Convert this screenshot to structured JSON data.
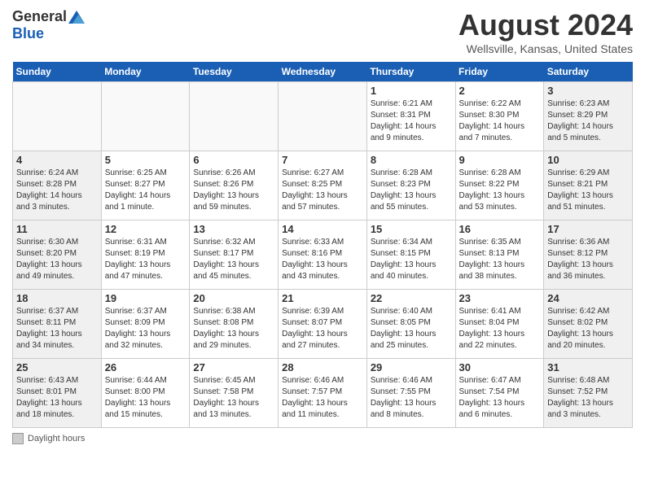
{
  "header": {
    "logo_general": "General",
    "logo_blue": "Blue",
    "month_year": "August 2024",
    "location": "Wellsville, Kansas, United States"
  },
  "days_of_week": [
    "Sunday",
    "Monday",
    "Tuesday",
    "Wednesday",
    "Thursday",
    "Friday",
    "Saturday"
  ],
  "legend": {
    "label": "Daylight hours"
  },
  "weeks": [
    [
      {
        "date": "",
        "sunrise": "",
        "sunset": "",
        "daylight": ""
      },
      {
        "date": "",
        "sunrise": "",
        "sunset": "",
        "daylight": ""
      },
      {
        "date": "",
        "sunrise": "",
        "sunset": "",
        "daylight": ""
      },
      {
        "date": "",
        "sunrise": "",
        "sunset": "",
        "daylight": ""
      },
      {
        "date": "1",
        "sunrise": "Sunrise: 6:21 AM",
        "sunset": "Sunset: 8:31 PM",
        "daylight": "Daylight: 14 hours and 9 minutes."
      },
      {
        "date": "2",
        "sunrise": "Sunrise: 6:22 AM",
        "sunset": "Sunset: 8:30 PM",
        "daylight": "Daylight: 14 hours and 7 minutes."
      },
      {
        "date": "3",
        "sunrise": "Sunrise: 6:23 AM",
        "sunset": "Sunset: 8:29 PM",
        "daylight": "Daylight: 14 hours and 5 minutes."
      }
    ],
    [
      {
        "date": "4",
        "sunrise": "Sunrise: 6:24 AM",
        "sunset": "Sunset: 8:28 PM",
        "daylight": "Daylight: 14 hours and 3 minutes."
      },
      {
        "date": "5",
        "sunrise": "Sunrise: 6:25 AM",
        "sunset": "Sunset: 8:27 PM",
        "daylight": "Daylight: 14 hours and 1 minute."
      },
      {
        "date": "6",
        "sunrise": "Sunrise: 6:26 AM",
        "sunset": "Sunset: 8:26 PM",
        "daylight": "Daylight: 13 hours and 59 minutes."
      },
      {
        "date": "7",
        "sunrise": "Sunrise: 6:27 AM",
        "sunset": "Sunset: 8:25 PM",
        "daylight": "Daylight: 13 hours and 57 minutes."
      },
      {
        "date": "8",
        "sunrise": "Sunrise: 6:28 AM",
        "sunset": "Sunset: 8:23 PM",
        "daylight": "Daylight: 13 hours and 55 minutes."
      },
      {
        "date": "9",
        "sunrise": "Sunrise: 6:28 AM",
        "sunset": "Sunset: 8:22 PM",
        "daylight": "Daylight: 13 hours and 53 minutes."
      },
      {
        "date": "10",
        "sunrise": "Sunrise: 6:29 AM",
        "sunset": "Sunset: 8:21 PM",
        "daylight": "Daylight: 13 hours and 51 minutes."
      }
    ],
    [
      {
        "date": "11",
        "sunrise": "Sunrise: 6:30 AM",
        "sunset": "Sunset: 8:20 PM",
        "daylight": "Daylight: 13 hours and 49 minutes."
      },
      {
        "date": "12",
        "sunrise": "Sunrise: 6:31 AM",
        "sunset": "Sunset: 8:19 PM",
        "daylight": "Daylight: 13 hours and 47 minutes."
      },
      {
        "date": "13",
        "sunrise": "Sunrise: 6:32 AM",
        "sunset": "Sunset: 8:17 PM",
        "daylight": "Daylight: 13 hours and 45 minutes."
      },
      {
        "date": "14",
        "sunrise": "Sunrise: 6:33 AM",
        "sunset": "Sunset: 8:16 PM",
        "daylight": "Daylight: 13 hours and 43 minutes."
      },
      {
        "date": "15",
        "sunrise": "Sunrise: 6:34 AM",
        "sunset": "Sunset: 8:15 PM",
        "daylight": "Daylight: 13 hours and 40 minutes."
      },
      {
        "date": "16",
        "sunrise": "Sunrise: 6:35 AM",
        "sunset": "Sunset: 8:13 PM",
        "daylight": "Daylight: 13 hours and 38 minutes."
      },
      {
        "date": "17",
        "sunrise": "Sunrise: 6:36 AM",
        "sunset": "Sunset: 8:12 PM",
        "daylight": "Daylight: 13 hours and 36 minutes."
      }
    ],
    [
      {
        "date": "18",
        "sunrise": "Sunrise: 6:37 AM",
        "sunset": "Sunset: 8:11 PM",
        "daylight": "Daylight: 13 hours and 34 minutes."
      },
      {
        "date": "19",
        "sunrise": "Sunrise: 6:37 AM",
        "sunset": "Sunset: 8:09 PM",
        "daylight": "Daylight: 13 hours and 32 minutes."
      },
      {
        "date": "20",
        "sunrise": "Sunrise: 6:38 AM",
        "sunset": "Sunset: 8:08 PM",
        "daylight": "Daylight: 13 hours and 29 minutes."
      },
      {
        "date": "21",
        "sunrise": "Sunrise: 6:39 AM",
        "sunset": "Sunset: 8:07 PM",
        "daylight": "Daylight: 13 hours and 27 minutes."
      },
      {
        "date": "22",
        "sunrise": "Sunrise: 6:40 AM",
        "sunset": "Sunset: 8:05 PM",
        "daylight": "Daylight: 13 hours and 25 minutes."
      },
      {
        "date": "23",
        "sunrise": "Sunrise: 6:41 AM",
        "sunset": "Sunset: 8:04 PM",
        "daylight": "Daylight: 13 hours and 22 minutes."
      },
      {
        "date": "24",
        "sunrise": "Sunrise: 6:42 AM",
        "sunset": "Sunset: 8:02 PM",
        "daylight": "Daylight: 13 hours and 20 minutes."
      }
    ],
    [
      {
        "date": "25",
        "sunrise": "Sunrise: 6:43 AM",
        "sunset": "Sunset: 8:01 PM",
        "daylight": "Daylight: 13 hours and 18 minutes."
      },
      {
        "date": "26",
        "sunrise": "Sunrise: 6:44 AM",
        "sunset": "Sunset: 8:00 PM",
        "daylight": "Daylight: 13 hours and 15 minutes."
      },
      {
        "date": "27",
        "sunrise": "Sunrise: 6:45 AM",
        "sunset": "Sunset: 7:58 PM",
        "daylight": "Daylight: 13 hours and 13 minutes."
      },
      {
        "date": "28",
        "sunrise": "Sunrise: 6:46 AM",
        "sunset": "Sunset: 7:57 PM",
        "daylight": "Daylight: 13 hours and 11 minutes."
      },
      {
        "date": "29",
        "sunrise": "Sunrise: 6:46 AM",
        "sunset": "Sunset: 7:55 PM",
        "daylight": "Daylight: 13 hours and 8 minutes."
      },
      {
        "date": "30",
        "sunrise": "Sunrise: 6:47 AM",
        "sunset": "Sunset: 7:54 PM",
        "daylight": "Daylight: 13 hours and 6 minutes."
      },
      {
        "date": "31",
        "sunrise": "Sunrise: 6:48 AM",
        "sunset": "Sunset: 7:52 PM",
        "daylight": "Daylight: 13 hours and 3 minutes."
      }
    ]
  ]
}
